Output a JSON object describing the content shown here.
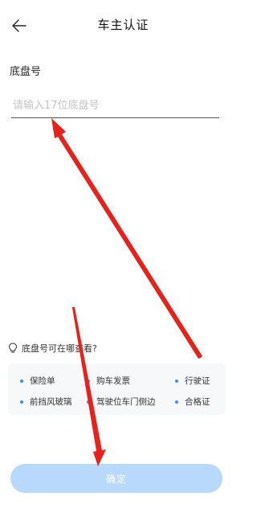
{
  "header": {
    "title": "车主认证",
    "back_icon": "arrow-left-icon"
  },
  "form": {
    "label": "底盘号",
    "input": {
      "placeholder": "请输入17位底盘号",
      "value": ""
    }
  },
  "hint": {
    "icon": "lightbulb-icon",
    "text": "底盘号可在哪查看?"
  },
  "locations": {
    "dot_color": "#3b8ff6",
    "items": [
      "保险单",
      "购车发票",
      "行驶证",
      "前挡风玻璃",
      "驾驶位车门侧边",
      "合格证"
    ]
  },
  "confirm": {
    "label": "确定",
    "color": "#b8d8fc"
  },
  "annotation_color": "#e8221b"
}
